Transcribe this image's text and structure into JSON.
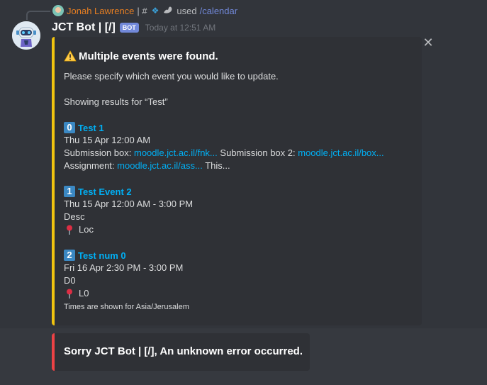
{
  "reply": {
    "name": "Jonah Lawrence",
    "separator": "| #",
    "used": "used",
    "command": "/calendar",
    "icons": [
      "reply-avatar-icon",
      "sparkle-emoji-icon",
      "flexed-arm-emoji-icon"
    ]
  },
  "message": {
    "author": "JCT Bot | [/]",
    "bot_tag": "BOT",
    "timestamp": "Today at 12:51 AM",
    "avatar_icon": "robot-avatar-icon"
  },
  "embed": {
    "accent_color": "#f1c40f",
    "title": "Multiple events were found.",
    "title_icon": "warning-icon",
    "description": "Please specify which event you would like to update.",
    "showing": "Showing results for “Test”",
    "events": [
      {
        "number": "0",
        "title": "Test 1",
        "date": "Thu 15 Apr 12:00 AM",
        "line1_prefix": "Submission box: ",
        "line1_link1": "moodle.jct.ac.il/fnk...",
        "line1_mid": " Submission box 2: ",
        "line1_link2": "moodle.jct.ac.il/box...",
        "line2_prefix": "Assignment: ",
        "line2_link": "moodle.jct.ac.il/ass...",
        "line2_suffix": " This..."
      },
      {
        "number": "1",
        "title": "Test Event 2",
        "date": "Thu 15 Apr 12:00 AM - 3:00 PM",
        "description": "Desc",
        "location": "Loc"
      },
      {
        "number": "2",
        "title": "Test num 0",
        "date": "Fri 16 Apr 2:30 PM - 3:00 PM",
        "description": "D0",
        "location": "L0"
      }
    ],
    "footer": "Times are shown for Asia/Jerusalem",
    "dismiss_icon": "close-icon"
  },
  "error_embed": {
    "accent_color": "#ed4245",
    "text": "Sorry JCT Bot | [/], An unknown error occurred."
  }
}
